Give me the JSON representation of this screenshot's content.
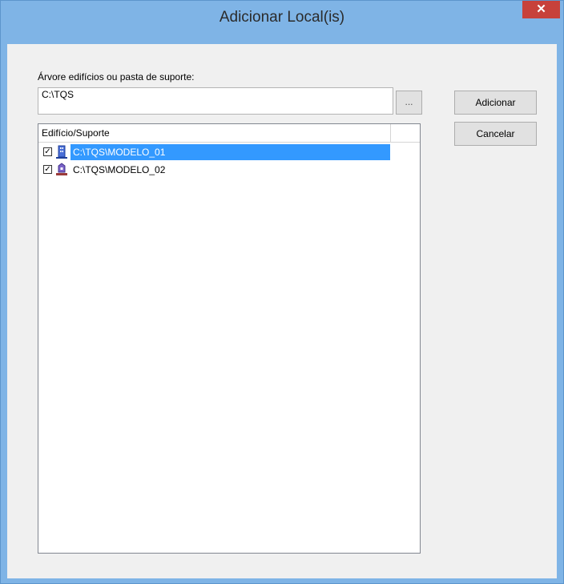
{
  "window": {
    "title": "Adicionar Local(is)",
    "close_glyph": "✕"
  },
  "form": {
    "path_label": "Árvore edifícios ou pasta de suporte:",
    "path_value": "C:\\TQS",
    "browse_label": "...",
    "add_label": "Adicionar",
    "cancel_label": "Cancelar"
  },
  "list": {
    "column_header": "Edifício/Suporte",
    "items": [
      {
        "label": "C:\\TQS\\MODELO_01",
        "checked": true,
        "selected": true,
        "icon": "building-icon"
      },
      {
        "label": "C:\\TQS\\MODELO_02",
        "checked": true,
        "selected": false,
        "icon": "support-icon"
      }
    ]
  },
  "colors": {
    "accent": "#3399ff",
    "close": "#c7413b",
    "frame": "#7fb4e6"
  }
}
